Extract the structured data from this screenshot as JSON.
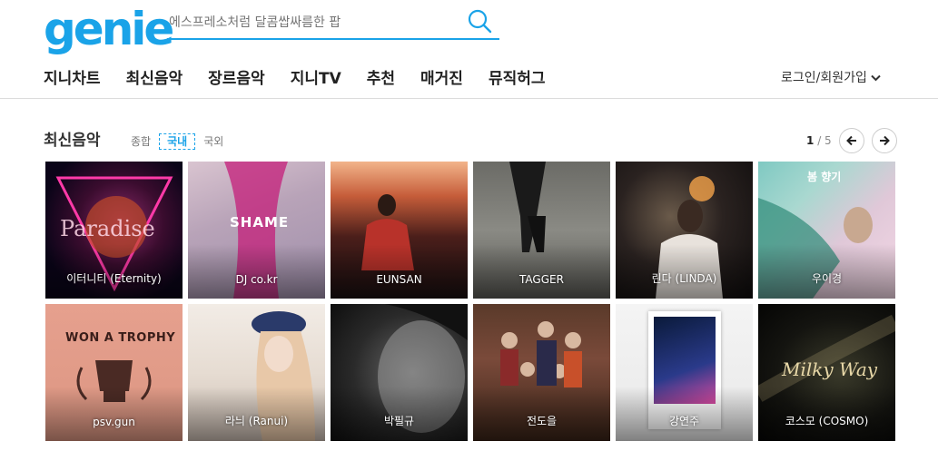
{
  "logo": "genie",
  "search": {
    "placeholder": "에스프레소처럼 달콤쌉싸름한 팝"
  },
  "nav": [
    "지니차트",
    "최신음악",
    "장르음악",
    "지니TV",
    "추천",
    "매거진",
    "뮤직허그"
  ],
  "login_label": "로그인/회원가입",
  "section": {
    "title": "최신음악",
    "tabs": [
      "종합",
      "국내",
      "국외"
    ],
    "active_tab": "국내",
    "page_current": "1",
    "page_total": "/ 5"
  },
  "albums": [
    {
      "artist": "이터니티 (Eternity)",
      "cover_text": "Paradise"
    },
    {
      "artist": "DJ co.kr",
      "cover_text": "SHAME"
    },
    {
      "artist": "EUNSAN"
    },
    {
      "artist": "TAGGER"
    },
    {
      "artist": "린다 (LINDA)"
    },
    {
      "artist": "우이경",
      "cover_text": "봄 향기"
    },
    {
      "artist": "psv.gun",
      "cover_text": "WON A TROPHY"
    },
    {
      "artist": "라늬 (Ranui)"
    },
    {
      "artist": "박필규"
    },
    {
      "artist": "전도을"
    },
    {
      "artist": "강연주"
    },
    {
      "artist": "코스모 (COSMO)",
      "cover_text": "Milky Way"
    }
  ],
  "colors": {
    "brand": "#1aa3e8"
  }
}
